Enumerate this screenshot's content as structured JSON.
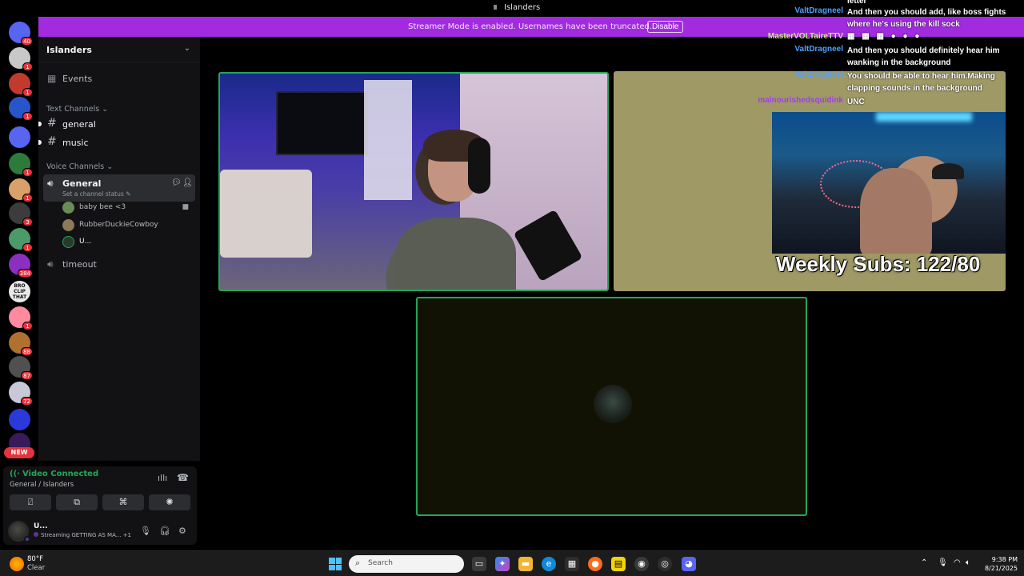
{
  "window": {
    "title": "Islanders"
  },
  "banner": {
    "message": "Streamer Mode is enabled. Usernames have been truncated.",
    "disable_label": "Disable",
    "color": "#a22be0"
  },
  "rail": {
    "servers": [
      {
        "badge": "40",
        "color": "#5865f2",
        "icon": "discord-home-icon"
      },
      {
        "badge": "1",
        "color": "#c8c8c8"
      },
      {
        "badge": "1",
        "color": "#c23a2e"
      },
      {
        "badge": "1",
        "color": "#2855c8"
      },
      {
        "badge": "",
        "color": "#5865f2"
      },
      {
        "badge": "1",
        "color": "#2c7a3c"
      },
      {
        "badge": "1",
        "color": "#d9a06a"
      },
      {
        "badge": "3",
        "color": "#3c3c3c"
      },
      {
        "badge": "1",
        "color": "#4c9a6a"
      },
      {
        "badge": "384",
        "color": "#8a2fc0"
      },
      {
        "badge": "",
        "color": "#eaeaea",
        "text": "BRO CLIP THAT"
      },
      {
        "badge": "1",
        "color": "#ff8aa0"
      },
      {
        "badge": "88",
        "color": "#b07030"
      },
      {
        "badge": "87",
        "color": "#505050"
      },
      {
        "badge": "72",
        "color": "#c8c8d8"
      },
      {
        "badge": "",
        "color": "#2a3ad8",
        "icon": "folder-icon"
      },
      {
        "badge": "",
        "color": "#3a1a5a"
      }
    ],
    "new_label": "NEW"
  },
  "sidebar": {
    "guild_name": "Islanders",
    "events_label": "Events",
    "text_category": "Text Channels",
    "text_channels": [
      "general",
      "music"
    ],
    "voice_category": "Voice Channels",
    "voice_active": {
      "name": "General",
      "status": "Set a channel status"
    },
    "members": [
      {
        "name": "baby bee <3",
        "color": "#6a8a5a",
        "camera": true
      },
      {
        "name": "RubberDuckieCowboy",
        "color": "#8a7a5a",
        "camera": false
      },
      {
        "name": "U...",
        "color": "#2a3a2a",
        "camera": false
      }
    ],
    "voice_other": "timeout"
  },
  "voice_panel": {
    "status": "Video Connected",
    "location": "General / Islanders",
    "user_name": "U...",
    "user_status": "Streaming GETTING AS MA...",
    "user_status_extra": "+1"
  },
  "stream": {
    "subs_overlay": "Weekly Subs: 122/80",
    "chat": [
      {
        "name": "",
        "text": "letter",
        "color": "#ffffff"
      },
      {
        "name": "ValtDragneel",
        "text": "And then you should add, like boss fights where he's using the kill sock",
        "color": "#4ea0ff"
      },
      {
        "name": "MasterVOLTaireTTV",
        "text": "",
        "color": "#c8f078"
      },
      {
        "name": "ValtDragneel",
        "text": "And then you should definitely hear him wanking in the background",
        "color": "#4ea0ff"
      },
      {
        "name": "ValtDragneel",
        "text": "You should be able to hear him.Making clapping sounds in the background",
        "color": "#4ea0ff"
      },
      {
        "name": "malnourishedsquidink",
        "text": "UNC",
        "color": "#a040e0"
      }
    ]
  },
  "taskbar": {
    "weather_temp": "80°F",
    "weather_cond": "Clear",
    "search_placeholder": "Search",
    "time": "9:38 PM",
    "date": "8/21/2025"
  }
}
